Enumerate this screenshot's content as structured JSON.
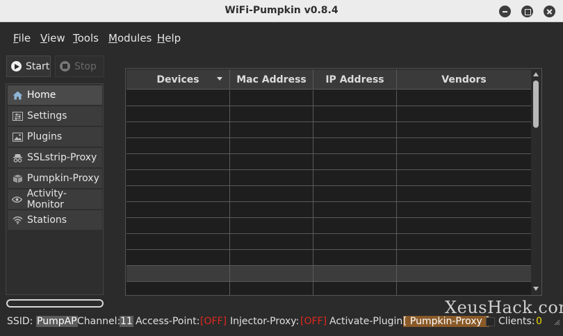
{
  "window": {
    "title": "WiFi-Pumpkin v0.8.4"
  },
  "menu": [
    {
      "pre": "",
      "acc": "F",
      "post": "ile"
    },
    {
      "pre": "",
      "acc": "V",
      "post": "iew"
    },
    {
      "pre": "",
      "acc": "T",
      "post": "ools"
    },
    {
      "pre": "",
      "acc": "M",
      "post": "odules"
    },
    {
      "pre": "",
      "acc": "H",
      "post": "elp"
    }
  ],
  "toolbar": {
    "start_label": "Start",
    "stop_label": "Stop"
  },
  "sidebar": {
    "items": [
      {
        "label": "Home",
        "icon": "home-icon"
      },
      {
        "label": "Settings",
        "icon": "settings-sliders-icon"
      },
      {
        "label": "Plugins",
        "icon": "plugins-image-icon"
      },
      {
        "label": "SSLstrip-Proxy",
        "icon": "spy-icon"
      },
      {
        "label": "Pumpkin-Proxy",
        "icon": "box-icon"
      },
      {
        "label": "Activity-Monitor",
        "icon": "eye-icon"
      },
      {
        "label": "Stations",
        "icon": "wifi-icon"
      }
    ]
  },
  "table": {
    "columns": [
      "Devices",
      "Mac Address",
      "IP Address",
      "Vendors"
    ]
  },
  "status": {
    "ssid_label": "SSID:",
    "ssid_value": "PumpAP",
    "channel_label": "Channel:",
    "channel_value": "11",
    "access_point_label": "Access-Point:",
    "access_point_value": "[OFF]",
    "injector_label": "Injector-Proxy:",
    "injector_value": "[OFF]",
    "plugin_label": "Activate-Plugin:",
    "plugin_value": "[ Pumpkin-Proxy ]",
    "clients_label": "Clients:",
    "clients_value": "0"
  },
  "watermark": "XeusHack.com",
  "colors": {
    "off": "#e0281e",
    "plugin": "#8a5a28",
    "clients": "#f0d800"
  }
}
